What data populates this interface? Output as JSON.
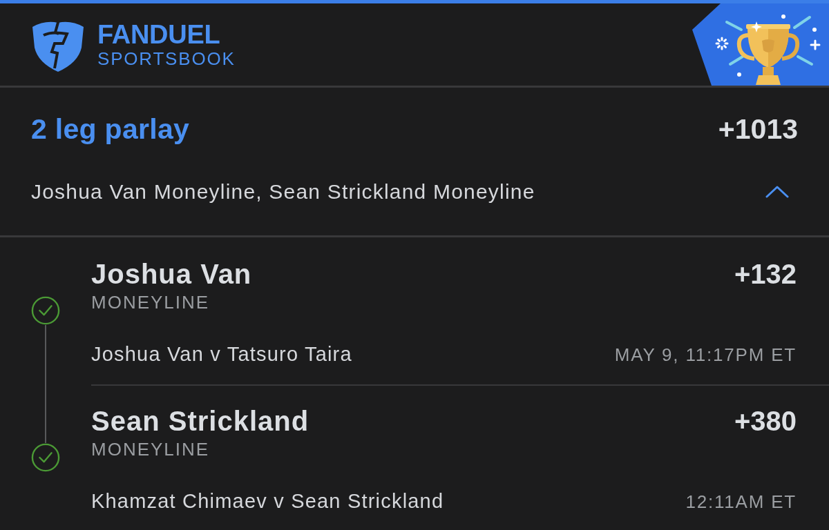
{
  "header": {
    "brand": "FANDUEL",
    "product": "SPORTSBOOK"
  },
  "parlay": {
    "title": "2 leg parlay",
    "odds": "+1013",
    "summary": "Joshua Van Moneyline, Sean Strickland Moneyline",
    "expanded": true
  },
  "legs": [
    {
      "selection": "Joshua Van",
      "market": "MONEYLINE",
      "odds": "+132",
      "event": "Joshua Van v Tatsuro Taira",
      "time": "MAY 9, 11:17PM ET",
      "won": true
    },
    {
      "selection": "Sean Strickland",
      "market": "MONEYLINE",
      "odds": "+380",
      "event": "Khamzat Chimaev v Sean Strickland",
      "time": "12:11AM ET",
      "won": true
    }
  ]
}
